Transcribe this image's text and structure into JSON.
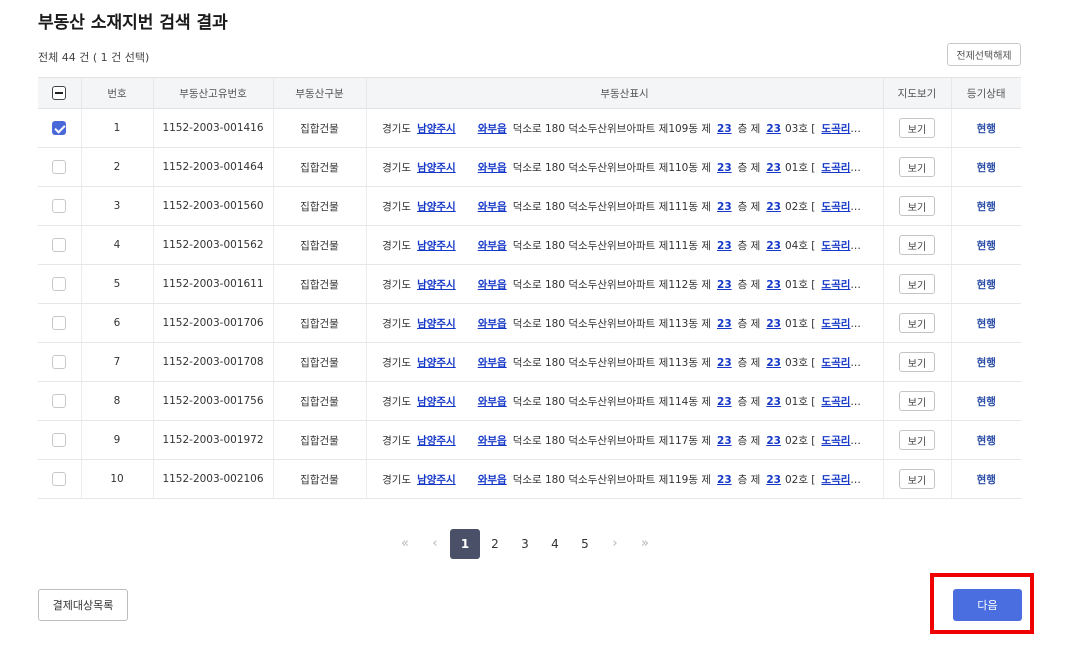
{
  "page": {
    "title": "부동산 소재지번 검색 결과",
    "summary": "전체 44 건 ( 1 건 선택)",
    "deselect_all_label": "전제선택해제"
  },
  "table": {
    "headers": [
      "번호",
      "부동산고유번호",
      "부동산구분",
      "부동산표시",
      "지도보기",
      "등기상태"
    ],
    "rows": [
      {
        "checked": true,
        "no": "1",
        "id": "1152-2003-001416",
        "type": "집합건물",
        "province": "경기도",
        "city": "남양주시",
        "town": "와부읍",
        "street": "덕소로 180 덕소두산위브아파트 제109동 제",
        "floor": "23",
        "floor_label": "층 제",
        "unit_no": "23",
        "unit_suffix": "03호 [",
        "village": "도곡리",
        "map": "보기",
        "status": "현행"
      },
      {
        "checked": false,
        "no": "2",
        "id": "1152-2003-001464",
        "type": "집합건물",
        "province": "경기도",
        "city": "남양주시",
        "town": "와부읍",
        "street": "덕소로 180 덕소두산위브아파트 제110동 제",
        "floor": "23",
        "floor_label": "층 제",
        "unit_no": "23",
        "unit_suffix": "01호 [",
        "village": "도곡리",
        "map": "보기",
        "status": "현행"
      },
      {
        "checked": false,
        "no": "3",
        "id": "1152-2003-001560",
        "type": "집합건물",
        "province": "경기도",
        "city": "남양주시",
        "town": "와부읍",
        "street": "덕소로 180 덕소두산위브아파트 제111동 제",
        "floor": "23",
        "floor_label": "층 제",
        "unit_no": "23",
        "unit_suffix": "02호 [",
        "village": "도곡리",
        "map": "보기",
        "status": "현행"
      },
      {
        "checked": false,
        "no": "4",
        "id": "1152-2003-001562",
        "type": "집합건물",
        "province": "경기도",
        "city": "남양주시",
        "town": "와부읍",
        "street": "덕소로 180 덕소두산위브아파트 제111동 제",
        "floor": "23",
        "floor_label": "층 제",
        "unit_no": "23",
        "unit_suffix": "04호 [",
        "village": "도곡리",
        "map": "보기",
        "status": "현행"
      },
      {
        "checked": false,
        "no": "5",
        "id": "1152-2003-001611",
        "type": "집합건물",
        "province": "경기도",
        "city": "남양주시",
        "town": "와부읍",
        "street": "덕소로 180 덕소두산위브아파트 제112동 제",
        "floor": "23",
        "floor_label": "층 제",
        "unit_no": "23",
        "unit_suffix": "01호 [",
        "village": "도곡리",
        "map": "보기",
        "status": "현행"
      },
      {
        "checked": false,
        "no": "6",
        "id": "1152-2003-001706",
        "type": "집합건물",
        "province": "경기도",
        "city": "남양주시",
        "town": "와부읍",
        "street": "덕소로 180 덕소두산위브아파트 제113동 제",
        "floor": "23",
        "floor_label": "층 제",
        "unit_no": "23",
        "unit_suffix": "01호 [",
        "village": "도곡리",
        "map": "보기",
        "status": "현행"
      },
      {
        "checked": false,
        "no": "7",
        "id": "1152-2003-001708",
        "type": "집합건물",
        "province": "경기도",
        "city": "남양주시",
        "town": "와부읍",
        "street": "덕소로 180 덕소두산위브아파트 제113동 제",
        "floor": "23",
        "floor_label": "층 제",
        "unit_no": "23",
        "unit_suffix": "03호 [",
        "village": "도곡리",
        "map": "보기",
        "status": "현행"
      },
      {
        "checked": false,
        "no": "8",
        "id": "1152-2003-001756",
        "type": "집합건물",
        "province": "경기도",
        "city": "남양주시",
        "town": "와부읍",
        "street": "덕소로 180 덕소두산위브아파트 제114동 제",
        "floor": "23",
        "floor_label": "층 제",
        "unit_no": "23",
        "unit_suffix": "01호 [",
        "village": "도곡리",
        "map": "보기",
        "status": "현행"
      },
      {
        "checked": false,
        "no": "9",
        "id": "1152-2003-001972",
        "type": "집합건물",
        "province": "경기도",
        "city": "남양주시",
        "town": "와부읍",
        "street": "덕소로 180 덕소두산위브아파트 제117동 제",
        "floor": "23",
        "floor_label": "층 제",
        "unit_no": "23",
        "unit_suffix": "02호 [",
        "village": "도곡리",
        "map": "보기",
        "status": "현행"
      },
      {
        "checked": false,
        "no": "10",
        "id": "1152-2003-002106",
        "type": "집합건물",
        "province": "경기도",
        "city": "남양주시",
        "town": "와부읍",
        "street": "덕소로 180 덕소두산위브아파트 제119동 제",
        "floor": "23",
        "floor_label": "층 제",
        "unit_no": "23",
        "unit_suffix": "02호 [",
        "village": "도곡리",
        "map": "보기",
        "status": "현행"
      }
    ]
  },
  "pagination": {
    "first_icon": "double-chevron-left-icon",
    "prev_icon": "chevron-left-icon",
    "pages": [
      "1",
      "2",
      "3",
      "4",
      "5"
    ],
    "current": "1",
    "next_icon": "chevron-right-icon",
    "last_icon": "double-chevron-right-icon"
  },
  "footer": {
    "payment_list_label": "결제대상목록",
    "next_label": "다음"
  },
  "colors": {
    "primary": "#4a6ee0",
    "link": "#1538c8",
    "highlight": "#f00000",
    "active_page": "#4a5068"
  }
}
